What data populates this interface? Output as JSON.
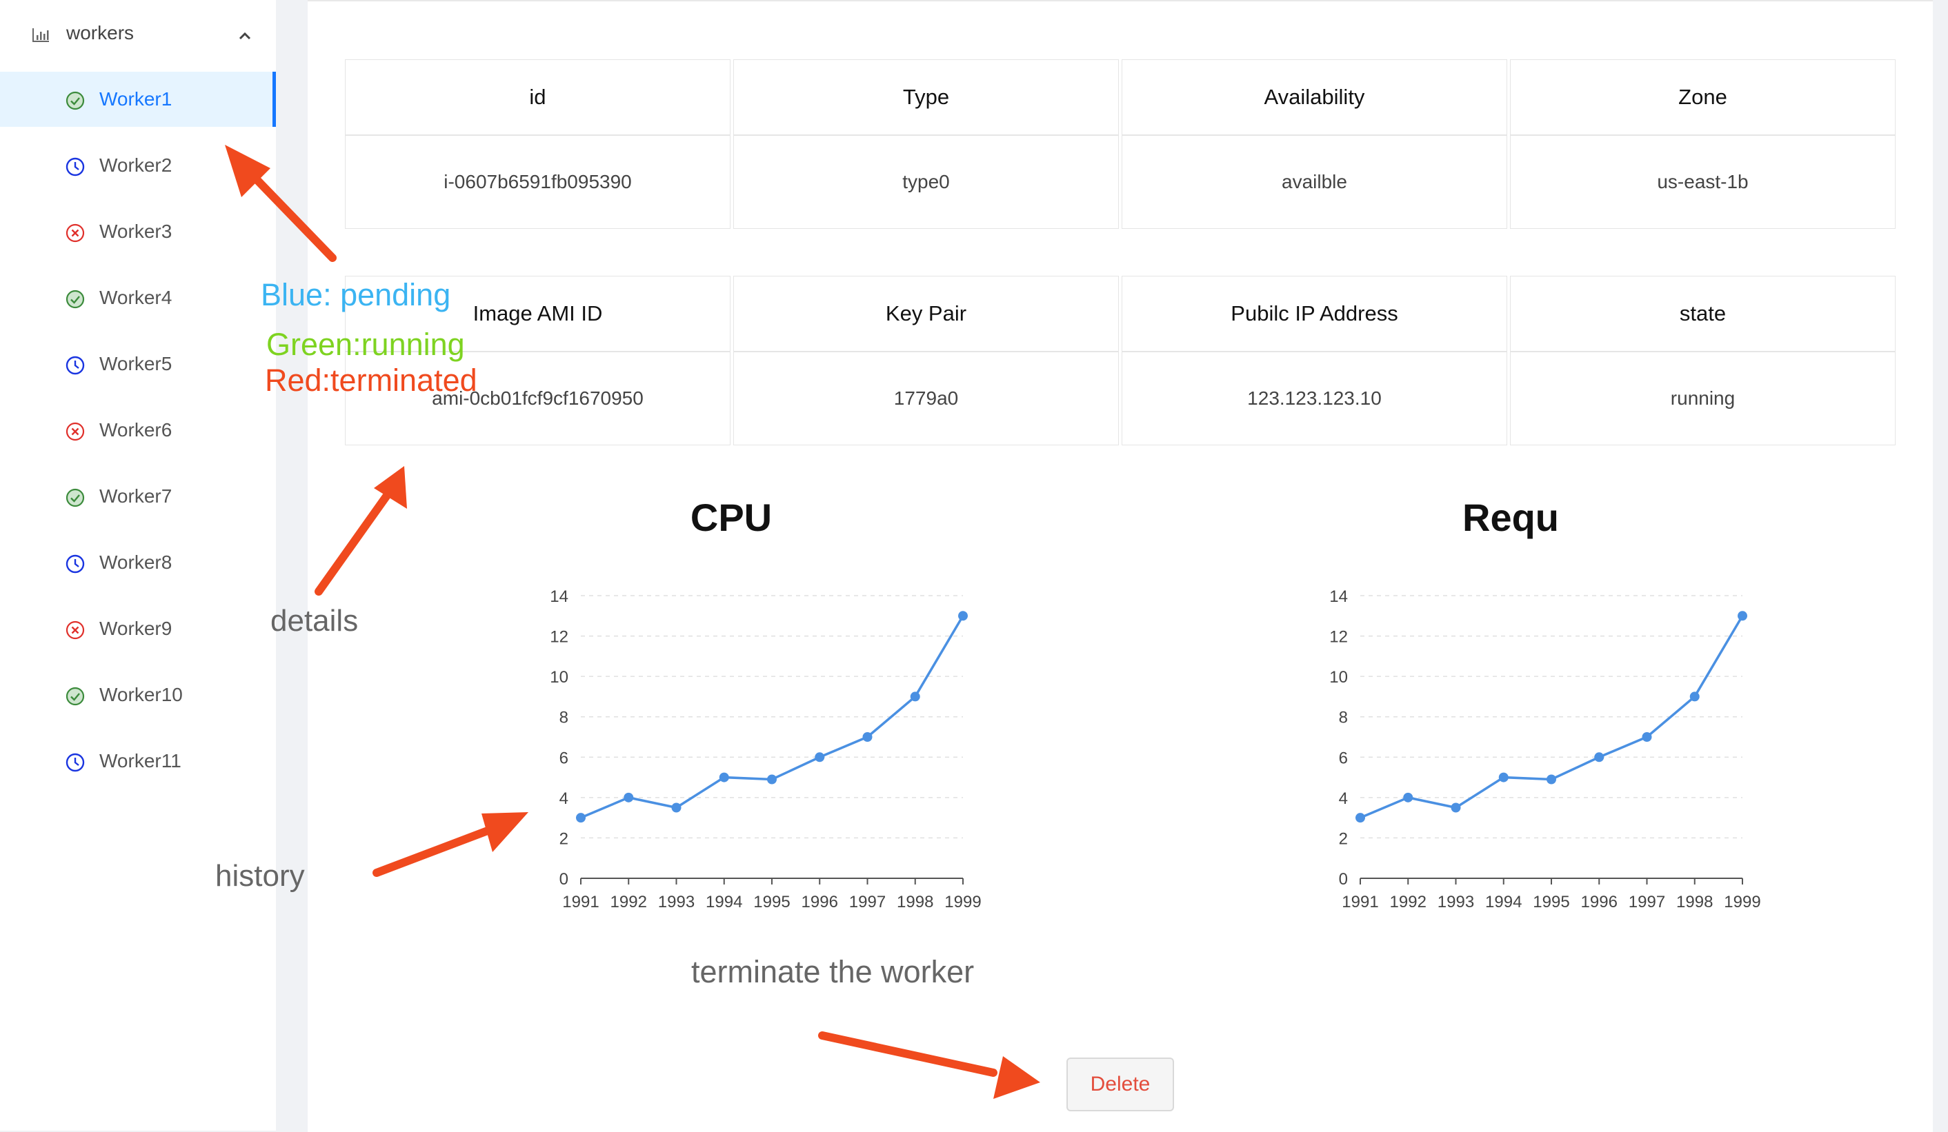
{
  "sidebar": {
    "submenu_title": "workers",
    "items": [
      {
        "label": "Worker1",
        "status": "running",
        "active": true
      },
      {
        "label": "Worker2",
        "status": "pending"
      },
      {
        "label": "Worker3",
        "status": "terminated"
      },
      {
        "label": "Worker4",
        "status": "running"
      },
      {
        "label": "Worker5",
        "status": "pending"
      },
      {
        "label": "Worker6",
        "status": "terminated"
      },
      {
        "label": "Worker7",
        "status": "running"
      },
      {
        "label": "Worker8",
        "status": "pending"
      },
      {
        "label": "Worker9",
        "status": "terminated"
      },
      {
        "label": "Worker10",
        "status": "running"
      },
      {
        "label": "Worker11",
        "status": "pending"
      }
    ]
  },
  "details": {
    "table1": {
      "headers": [
        "id",
        "Type",
        "Availability",
        "Zone"
      ],
      "values": [
        "i-0607b6591fb095390",
        "type0",
        "availble",
        "us-east-1b"
      ]
    },
    "table2": {
      "headers": [
        "Image AMI ID",
        "Key Pair",
        "Pubilc IP Address",
        "state"
      ],
      "values": [
        "ami-0cb01fcf9cf1670950",
        "1779a0",
        "123.123.123.10",
        "running"
      ]
    }
  },
  "chart_data": [
    {
      "type": "line",
      "title": "CPU",
      "x": [
        "1991",
        "1992",
        "1993",
        "1994",
        "1995",
        "1996",
        "1997",
        "1998",
        "1999"
      ],
      "values": [
        3,
        4,
        3.5,
        5,
        4.9,
        6,
        7,
        9,
        13
      ],
      "ylim": [
        0,
        14
      ],
      "yticks": [
        0,
        2,
        4,
        6,
        8,
        10,
        12,
        14
      ],
      "grid": true,
      "color": "#4a90e2"
    },
    {
      "type": "line",
      "title": "Requ",
      "x": [
        "1991",
        "1992",
        "1993",
        "1994",
        "1995",
        "1996",
        "1997",
        "1998",
        "1999"
      ],
      "values": [
        3,
        4,
        3.5,
        5,
        4.9,
        6,
        7,
        9,
        13
      ],
      "ylim": [
        0,
        14
      ],
      "yticks": [
        0,
        2,
        4,
        6,
        8,
        10,
        12,
        14
      ],
      "grid": true,
      "color": "#4a90e2"
    }
  ],
  "annotations": {
    "legend_pending": "Blue: pending",
    "legend_running": "Green:running",
    "legend_terminated": "Red:terminated",
    "details": "details",
    "history": "history",
    "terminate": "terminate the worker"
  },
  "actions": {
    "delete_label": "Delete"
  },
  "colors": {
    "accent": "#1677ff",
    "running": "#3c8b3c",
    "pending": "#1a35e0",
    "terminated": "#e0302b",
    "arrow": "#f04a1e"
  }
}
